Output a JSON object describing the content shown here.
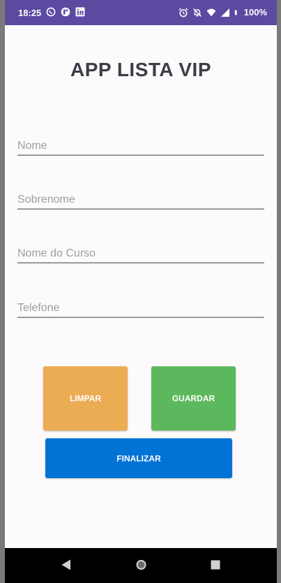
{
  "status_bar": {
    "time": "18:25",
    "battery": "100%",
    "icons_left": [
      "whatsapp-icon",
      "news-icon",
      "linkedin-icon"
    ],
    "icons_right": [
      "alarm-icon",
      "mute-icon",
      "wifi-icon",
      "signal-icon",
      "battery-icon"
    ]
  },
  "app": {
    "title": "APP LISTA VIP"
  },
  "form": {
    "nome": {
      "value": "",
      "placeholder": "Nome"
    },
    "sobrenome": {
      "value": "",
      "placeholder": "Sobrenome"
    },
    "curso": {
      "value": "",
      "placeholder": "Nome do Curso"
    },
    "telefone": {
      "value": "",
      "placeholder": "Telefone"
    }
  },
  "buttons": {
    "limpar": "LIMPAR",
    "guardar": "GUARDAR",
    "finalizar": "FINALIZAR"
  },
  "colors": {
    "status_bar": "#5b4aa0",
    "limpar": "#ecac53",
    "guardar": "#5cb85c",
    "finalizar": "#0073d4",
    "title": "#3d3d48"
  },
  "nav_bar": {
    "icons": [
      "back-icon",
      "home-icon",
      "recents-icon"
    ]
  }
}
